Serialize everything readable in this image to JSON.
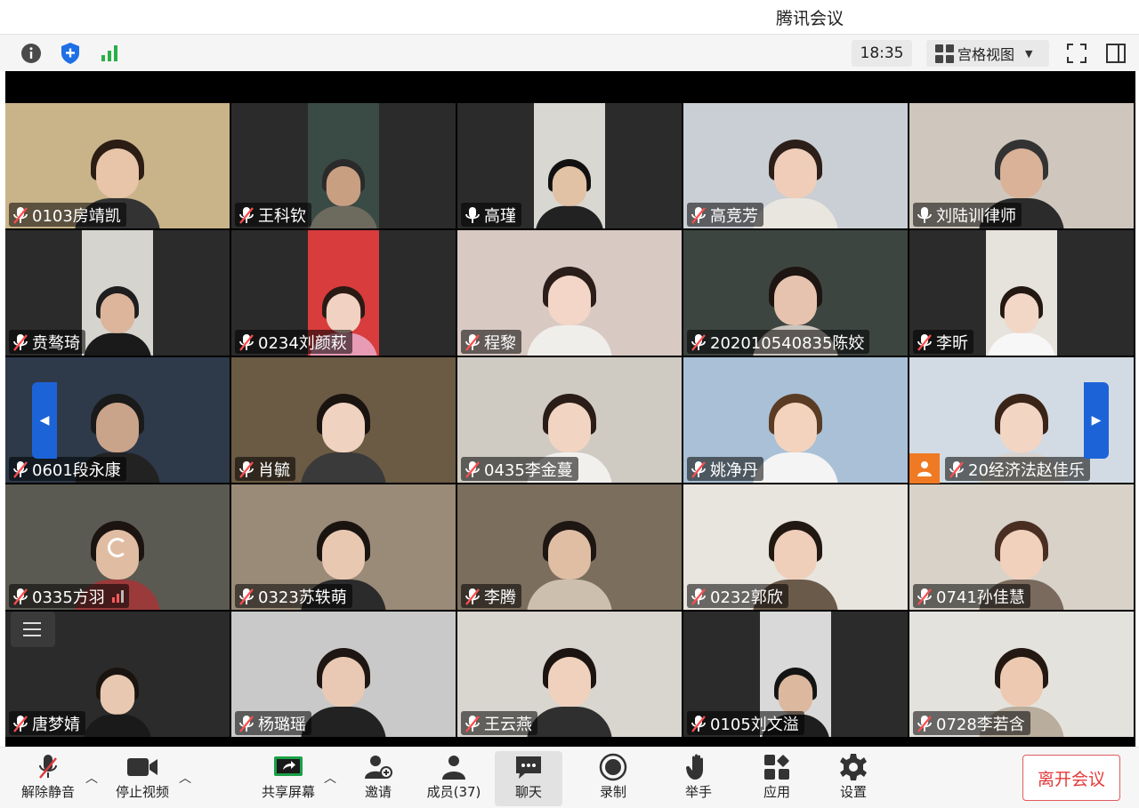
{
  "window": {
    "title": "腾讯会议"
  },
  "topbar": {
    "info_icon": "info-icon",
    "shield_icon": "shield-icon",
    "signal_icon": "signal-bars-icon",
    "time": "18:35",
    "view_label": "宫格视图",
    "fullscreen_icon": "fullscreen-icon",
    "sidebar_icon": "sidebar-toggle-icon"
  },
  "participants": [
    {
      "name": "0103房靖凯",
      "mic": "muted",
      "bg": "#c9b48a",
      "skin": "#e8c4a8",
      "hair": "#2b1c14",
      "shirt": "#333"
    },
    {
      "name": "王科钦",
      "mic": "muted",
      "bg": "#3a4a44",
      "skin": "#c99f82",
      "hair": "#2a2a2a",
      "shirt": "#6d6a5e"
    },
    {
      "name": "高瑾",
      "mic": "on",
      "bg": "#d9d7d2",
      "skin": "#e2c2a4",
      "hair": "#111",
      "shirt": "#222"
    },
    {
      "name": "高竞芳",
      "mic": "muted",
      "bg": "#c9cfd4",
      "skin": "#f0cdb8",
      "hair": "#2c1e18",
      "shirt": "#e9e6e0"
    },
    {
      "name": "刘陆训律师",
      "mic": "on",
      "bg": "#cfc7bd",
      "skin": "#d9b298",
      "hair": "#333",
      "shirt": "#2b2b2b"
    },
    {
      "name": "贲骜琦",
      "mic": "muted",
      "bg": "#d6d4cf",
      "skin": "#dcb59a",
      "hair": "#1e1e1e",
      "shirt": "#1a1a1a"
    },
    {
      "name": "0234刘颜萩",
      "mic": "muted",
      "bg": "#d83c3c",
      "skin": "#f1d2c2",
      "hair": "#2a1a14",
      "shirt": "#e89bb5"
    },
    {
      "name": "程黎",
      "mic": "muted",
      "bg": "#d9c9c3",
      "skin": "#f3d6c7",
      "hair": "#2b1e1a",
      "shirt": "#f0eeeb"
    },
    {
      "name": "202010540835陈姣",
      "mic": "muted",
      "bg": "#3d4540",
      "skin": "#e6c3ae",
      "hair": "#1d1511",
      "shirt": "#c9c4bd"
    },
    {
      "name": "李昕",
      "mic": "muted",
      "bg": "#e6e2dc",
      "skin": "#f2d6c6",
      "hair": "#241812",
      "shirt": "#f7f7f7"
    },
    {
      "name": "0601段永康",
      "mic": "muted",
      "bg": "#2e3a4a",
      "skin": "#caa48a",
      "hair": "#1a1a1a",
      "shirt": "#222"
    },
    {
      "name": "肖毓",
      "mic": "muted",
      "bg": "#6b5a44",
      "skin": "#f0d2c0",
      "hair": "#1a1410",
      "shirt": "#3a3a3a"
    },
    {
      "name": "0435李金蔓",
      "mic": "muted",
      "bg": "#cfcac2",
      "skin": "#f2d4c2",
      "hair": "#2a1c16",
      "shirt": "#f2f0ed"
    },
    {
      "name": "姚净丹",
      "mic": "muted",
      "bg": "#a9c0d6",
      "skin": "#f3d3bd",
      "hair": "#5a3b24",
      "shirt": "#f4f4f4"
    },
    {
      "name": "20经济法赵佳乐",
      "mic": "muted",
      "bg": "#d2dbe3",
      "skin": "#f3d5c4",
      "hair": "#3a2418",
      "shirt": "#d9d4cf"
    },
    {
      "name": "0335方羽",
      "mic": "muted",
      "bg": "#5b5a52",
      "skin": "#e0bda2",
      "hair": "#1c1410",
      "shirt": "#9a3a3a"
    },
    {
      "name": "0323苏轶萌",
      "mic": "muted",
      "bg": "#9a8a78",
      "skin": "#e9c8b2",
      "hair": "#1a1410",
      "shirt": "#2b2b2b"
    },
    {
      "name": "李腾",
      "mic": "muted",
      "bg": "#7b6e5d",
      "skin": "#e0bea4",
      "hair": "#1e1612",
      "shirt": "#cdbfae"
    },
    {
      "name": "0232郭欣",
      "mic": "muted",
      "bg": "#e8e4de",
      "skin": "#efcfba",
      "hair": "#221812",
      "shirt": "#6a5a4a"
    },
    {
      "name": "0741孙佳慧",
      "mic": "muted",
      "bg": "#d8d2c8",
      "skin": "#f1d0bc",
      "hair": "#4a2e22",
      "shirt": "#7a6a5e"
    },
    {
      "name": "唐梦婧",
      "mic": "muted",
      "bg": "#2b2b2b",
      "skin": "#e8c8b0",
      "hair": "#1a1410",
      "shirt": "#1a1a1a"
    },
    {
      "name": "杨璐瑶",
      "mic": "muted",
      "bg": "#c9c9c9",
      "skin": "#e9c9b3",
      "hair": "#1e1612",
      "shirt": "#222"
    },
    {
      "name": "王云燕",
      "mic": "muted",
      "bg": "#d9d5cf",
      "skin": "#f0d1bd",
      "hair": "#1c1410",
      "shirt": "#2f2f2f"
    },
    {
      "name": "0105刘文溢",
      "mic": "muted",
      "bg": "#d9d9d9",
      "skin": "#dcb89e",
      "hair": "#141414",
      "shirt": "#1e1e1e"
    },
    {
      "name": "0728李若含",
      "mic": "muted",
      "bg": "#e4e2dd",
      "skin": "#ecc9b0",
      "hair": "#241812",
      "shirt": "#b9ad9e"
    }
  ],
  "toolbar": {
    "unmute_label": "解除静音",
    "stop_video_label": "停止视频",
    "share_label": "共享屏幕",
    "invite_label": "邀请",
    "members_label": "成员(37)",
    "chat_label": "聊天",
    "record_label": "录制",
    "raise_hand_label": "举手",
    "apps_label": "应用",
    "settings_label": "设置",
    "leave_label": "离开会议"
  }
}
